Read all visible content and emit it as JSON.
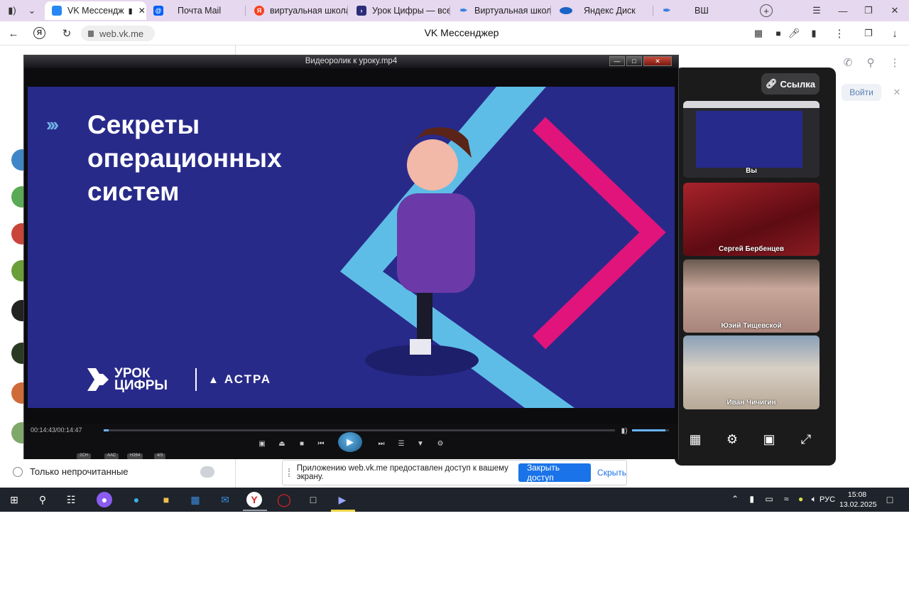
{
  "browser": {
    "tabs": [
      {
        "label": "VK Мессендж",
        "active": true,
        "fav_color": "#2787f5"
      },
      {
        "label": "Почта Mail",
        "fav_color": "#005ff9"
      },
      {
        "label": "виртуальная школа -",
        "fav_color": "#fc3f1d"
      },
      {
        "label": "Урок Цифры — всерс",
        "fav_color": "#2b2d7a"
      },
      {
        "label": "Виртуальная школа",
        "fav_color": "#2f7de1"
      },
      {
        "label": "Яндекс Диск",
        "fav_color": "#1a63c7"
      },
      {
        "label": "ВШ",
        "fav_color": "#2f7de1"
      }
    ],
    "url": "web.vk.me",
    "page_title": "VK Мессенджер"
  },
  "vk": {
    "unread_label": "Только непрочитанные",
    "join_label": "Войти"
  },
  "call": {
    "link_label": "Ссылка",
    "participants": [
      {
        "name": "Вы"
      },
      {
        "name": "Сергей Бербенцев"
      },
      {
        "name": "Юэий Тищевской"
      },
      {
        "name": "Иван Чичигин"
      }
    ]
  },
  "player": {
    "window_title": "Видеоролик к уроку.mp4",
    "time_display": "00:14:43/00:14:47",
    "progress_fraction": 0.01,
    "volume_fraction": 0.9,
    "tags": [
      "2CH",
      "AAC",
      "H264",
      "4/3"
    ]
  },
  "video": {
    "title": "Секреты операционных систем",
    "logo1": "УРОК ЦИФРЫ",
    "logo2": "АСТРА",
    "colors": {
      "background": "#282a8a",
      "stripe": "#5ebde6",
      "accent": "#e0147a"
    }
  },
  "share_notice": {
    "text": "Приложению web.vk.me предоставлен доступ к вашему экрану.",
    "stop_label": "Закрыть доступ",
    "hide_label": "Скрыть"
  },
  "taskbar": {
    "language": "РУС",
    "time": "15:08",
    "date": "13.02.2025"
  }
}
